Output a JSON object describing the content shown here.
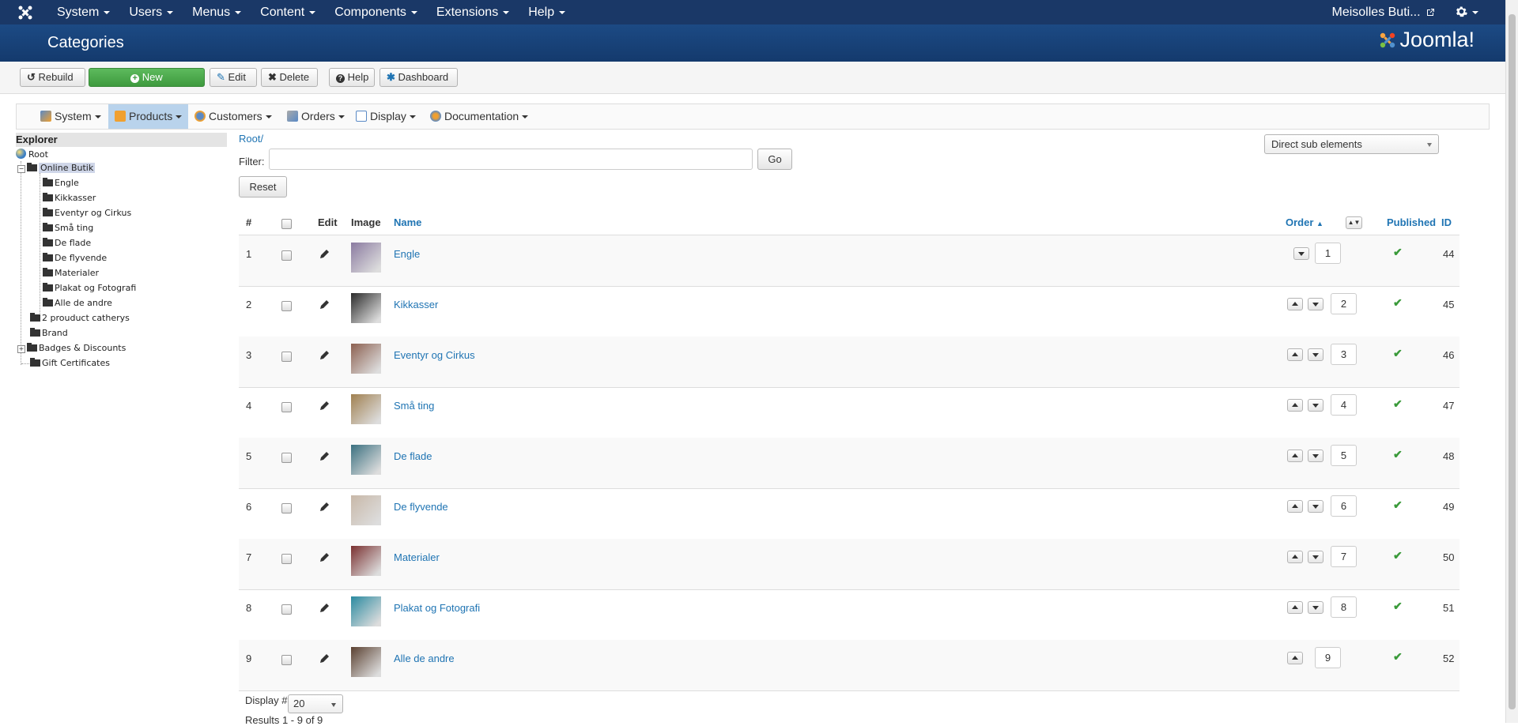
{
  "topnav": {
    "menu": [
      "System",
      "Users",
      "Menus",
      "Content",
      "Components",
      "Extensions",
      "Help"
    ],
    "site_name": "Meisolles Buti..."
  },
  "header": {
    "title": "Categories",
    "brand": "Joomla!"
  },
  "toolbar": {
    "rebuild": "Rebuild",
    "new": "New",
    "edit": "Edit",
    "delete": "Delete",
    "help": "Help",
    "dashboard": "Dashboard"
  },
  "subnav": {
    "items": [
      "System",
      "Products",
      "Customers",
      "Orders",
      "Display",
      "Documentation"
    ],
    "active": "Products"
  },
  "explorer": {
    "title": "Explorer",
    "root": "Root",
    "selected": "Online Butik",
    "children": [
      "Engle",
      "Kikkasser",
      "Eventyr og Cirkus",
      "Små ting",
      "De flade",
      "De flyvende",
      "Materialer",
      "Plakat og Fotografi",
      "Alle de andre"
    ],
    "siblings": [
      "2 prouduct catherys",
      "Brand",
      "Badges & Discounts",
      "Gift Certificates"
    ]
  },
  "main": {
    "breadcrumb": "Root/",
    "filter_label": "Filter:",
    "filter_value": "",
    "go": "Go",
    "reset": "Reset",
    "scope_select": "Direct sub elements",
    "columns": {
      "num": "#",
      "edit": "Edit",
      "image": "Image",
      "name": "Name",
      "order": "Order",
      "published": "Published",
      "id": "ID"
    },
    "rows": [
      {
        "num": "1",
        "name": "Engle",
        "order": "1",
        "id": "44",
        "thumb": "#8a7aa0"
      },
      {
        "num": "2",
        "name": "Kikkasser",
        "order": "2",
        "id": "45",
        "thumb": "#2a2a2a"
      },
      {
        "num": "3",
        "name": "Eventyr og Cirkus",
        "order": "3",
        "id": "46",
        "thumb": "#8c6050"
      },
      {
        "num": "4",
        "name": "Små ting",
        "order": "4",
        "id": "47",
        "thumb": "#a08050"
      },
      {
        "num": "5",
        "name": "De flade",
        "order": "5",
        "id": "48",
        "thumb": "#3a7080"
      },
      {
        "num": "6",
        "name": "De flyvende",
        "order": "6",
        "id": "49",
        "thumb": "#c8b8a8"
      },
      {
        "num": "7",
        "name": "Materialer",
        "order": "7",
        "id": "50",
        "thumb": "#7a3030"
      },
      {
        "num": "8",
        "name": "Plakat og Fotografi",
        "order": "8",
        "id": "51",
        "thumb": "#2a8aa0"
      },
      {
        "num": "9",
        "name": "Alle de andre",
        "order": "9",
        "id": "52",
        "thumb": "#5a4030"
      }
    ],
    "display_label": "Display #",
    "display_value": "20",
    "results": "Results 1 - 9 of 9"
  },
  "colors": {
    "topnav": "#1a3867",
    "header": "#1c4a84",
    "link": "#1f74b3",
    "new_button": "#4cae4c",
    "published": "#3a9a3a"
  }
}
